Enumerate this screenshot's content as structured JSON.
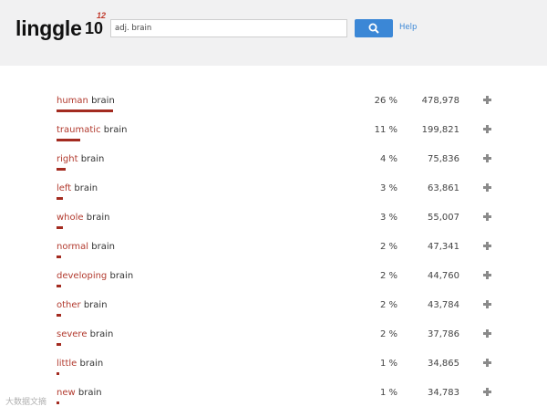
{
  "header": {
    "logo": "linggle",
    "version": "10",
    "version_sup": "12",
    "search_value": "adj. brain",
    "help": "Help"
  },
  "results": [
    {
      "modifier": "human",
      "head": "brain",
      "percent": "26 %",
      "count": "478,978",
      "share": 0.26
    },
    {
      "modifier": "traumatic",
      "head": "brain",
      "percent": "11 %",
      "count": "199,821",
      "share": 0.11
    },
    {
      "modifier": "right",
      "head": "brain",
      "percent": "4 %",
      "count": "75,836",
      "share": 0.04
    },
    {
      "modifier": "left",
      "head": "brain",
      "percent": "3 %",
      "count": "63,861",
      "share": 0.03
    },
    {
      "modifier": "whole",
      "head": "brain",
      "percent": "3 %",
      "count": "55,007",
      "share": 0.03
    },
    {
      "modifier": "normal",
      "head": "brain",
      "percent": "2 %",
      "count": "47,341",
      "share": 0.02
    },
    {
      "modifier": "developing",
      "head": "brain",
      "percent": "2 %",
      "count": "44,760",
      "share": 0.02
    },
    {
      "modifier": "other",
      "head": "brain",
      "percent": "2 %",
      "count": "43,784",
      "share": 0.02
    },
    {
      "modifier": "severe",
      "head": "brain",
      "percent": "2 %",
      "count": "37,786",
      "share": 0.02
    },
    {
      "modifier": "little",
      "head": "brain",
      "percent": "1 %",
      "count": "34,865",
      "share": 0.01
    },
    {
      "modifier": "new",
      "head": "brain",
      "percent": "1 %",
      "count": "34,783",
      "share": 0.01
    }
  ],
  "watermark": "大数据文摘",
  "colors": {
    "accent": "#3b87d6",
    "modifier": "#b23a2e",
    "bar": "#a32b20"
  },
  "icons": {
    "search": "search-icon",
    "expand": "plus-icon"
  }
}
